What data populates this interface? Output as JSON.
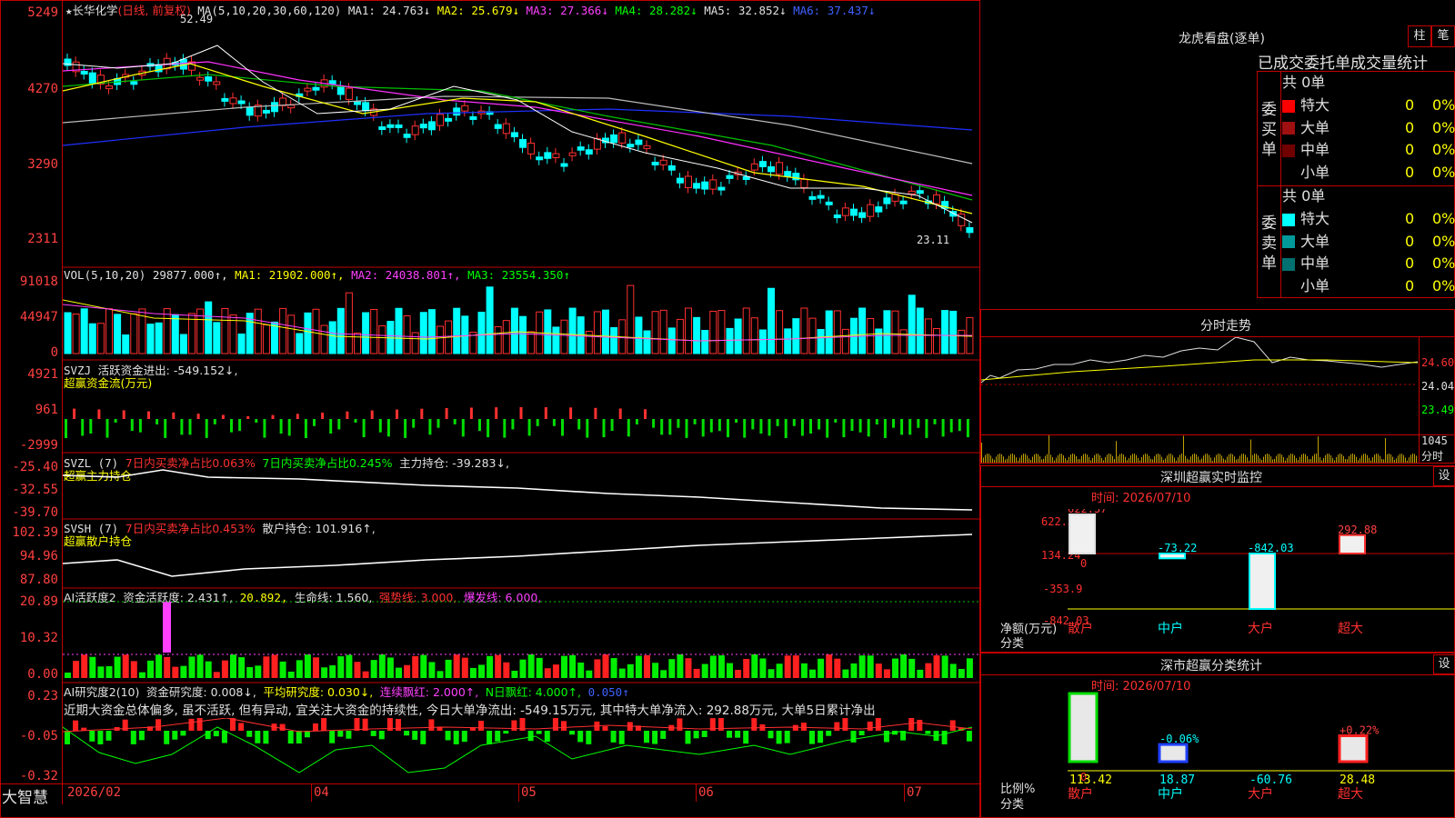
{
  "stock": {
    "star": "★",
    "name": "长华化学",
    "period": "(日线, 前复权)",
    "high_mark": "52.49",
    "low_mark": "23.11"
  },
  "ma_line": {
    "label": "MA(5,10,20,30,60,120)",
    "ma1": "MA1: 24.763↓",
    "ma2": "MA2: 25.679↓",
    "ma3": "MA3: 27.366↓",
    "ma4": "MA4: 28.282↓",
    "ma5": "MA5: 32.852↓",
    "ma6": "MA6: 37.437↓"
  },
  "price_axis": [
    "5249",
    "4270",
    "3290",
    "2311"
  ],
  "vol": {
    "label": "VOL(5,10,20)",
    "val": "29877.000↑,",
    "ma1": "MA1: 21902.000↑,",
    "ma2": "MA2: 24038.801↑,",
    "ma3": "MA3: 23554.350↑",
    "axis": [
      "91018",
      "44947",
      "0"
    ]
  },
  "svzj": {
    "label": "SVZJ",
    "line1": "活跃资金进出: -549.152↓,",
    "line2": "超赢资金流(万元)",
    "axis": [
      "4921",
      "961",
      "-2999"
    ]
  },
  "svzl": {
    "label": "SVZL (7)",
    "a": "7日内买卖净占比0.063%",
    "b": "7日内买卖净占比0.245%",
    "c": "主力持仓: -39.283↓,",
    "line2": "超赢主力持仓",
    "axis": [
      "-25.40",
      "-32.55",
      "-39.70"
    ]
  },
  "svsh": {
    "label": "SVSH (7)",
    "a": "7日内买卖净占比0.453%",
    "c": "散户持仓: 101.916↑,",
    "line2": "超赢散户持仓",
    "axis": [
      "102.39",
      "94.96",
      "87.80"
    ]
  },
  "ai1": {
    "label": "AI活跃度2",
    "a": "资金活跃度: 2.431↑,",
    "b": "20.892,",
    "c": "生命线: 1.560,",
    "d": "强势线: 3.000,",
    "e": "爆发线: 6.000,",
    "axis": [
      "20.89",
      "10.32",
      "0.00"
    ]
  },
  "ai2": {
    "label": "AI研究度2(10)",
    "a": "资金研究度: 0.008↓,",
    "b": "平均研究度: 0.030↓,",
    "c": "连续飘红: 2.000↑,",
    "d": "N日飘红: 4.000↑,",
    "e": "0.050↑",
    "comment": "近期大资金总体偏多, 虽不活跃, 但有异动, 宜关注大资金的持续性, 今日大单净流出: -549.15万元, 其中特大单净流入: 292.88万元, 大单5日累计净出",
    "axis": [
      "0.23",
      "-0.05",
      "-0.32"
    ]
  },
  "time_axis": {
    "brand": "大智慧",
    "labels": [
      "2026/02",
      "04",
      "05",
      "06",
      "07"
    ]
  },
  "longhu": {
    "title": "龙虎看盘(逐单)",
    "btn1": "柱",
    "btn2": "笔",
    "subtitle": "已成交委托单成交量统计",
    "buy": {
      "side": "委买单",
      "total": "共 0单",
      "rows": [
        {
          "name": "特大",
          "val": "0",
          "pct": "0%",
          "color": "#ff0000"
        },
        {
          "name": "大单",
          "val": "0",
          "pct": "0%",
          "color": "#a01010"
        },
        {
          "name": "中单",
          "val": "0",
          "pct": "0%",
          "color": "#700000"
        },
        {
          "name": "小单",
          "val": "0",
          "pct": "0%",
          "color": "#000000"
        }
      ]
    },
    "sell": {
      "side": "委卖单",
      "total": "共 0单",
      "rows": [
        {
          "name": "特大",
          "val": "0",
          "pct": "0%",
          "color": "#00ffff"
        },
        {
          "name": "大单",
          "val": "0",
          "pct": "0%",
          "color": "#009999"
        },
        {
          "name": "中单",
          "val": "0",
          "pct": "0%",
          "color": "#007070"
        },
        {
          "name": "小单",
          "val": "0",
          "pct": "0%",
          "color": "#000000"
        }
      ]
    }
  },
  "fenshi": {
    "title": "分时走势",
    "p1": "24.60",
    "p2": "24.04",
    "p3": "23.49",
    "vol": "1045",
    "vol_label": "分时"
  },
  "monitor": {
    "title": "深圳超赢实时监控",
    "btn": "设",
    "time": "时间: 2026/07/10",
    "axis": [
      "622.37",
      "134.24",
      "0",
      "-353.9",
      "-842.03"
    ],
    "ylabel": "净额(万元)",
    "xlabel": "分类",
    "cats": [
      "散户",
      "中户",
      "大户",
      "超大"
    ],
    "values": [
      622.37,
      -73.22,
      -842.03,
      292.88
    ],
    "value_labels": [
      "622.37",
      "-73.22",
      "-842.03",
      "292.88"
    ]
  },
  "classstat": {
    "title": "深市超赢分类统计",
    "btn": "设",
    "time": "时间: 2026/07/10",
    "axis": [
      "75",
      "50",
      "25",
      "0"
    ],
    "ylabel": "比例%",
    "xlabel": "分类",
    "cats": [
      "散户",
      "中户",
      "大户",
      "超大"
    ],
    "values": [
      113.42,
      18.87,
      -60.76,
      28.48
    ],
    "value_labels": [
      "113.42",
      "18.87",
      "-60.76",
      "28.48"
    ],
    "pct_labels": [
      "",
      "-0.06%",
      "",
      "+0.22%"
    ]
  },
  "chart_data": [
    {
      "type": "bar",
      "title": "深圳超赢实时监控",
      "ylabel": "净额(万元)",
      "xlabel": "分类",
      "categories": [
        "散户",
        "中户",
        "大户",
        "超大"
      ],
      "values": [
        622.37,
        -73.22,
        -842.03,
        292.88
      ],
      "ylim": [
        -842.03,
        622.37
      ]
    },
    {
      "type": "bar",
      "title": "深市超赢分类统计",
      "ylabel": "比例%",
      "xlabel": "分类",
      "categories": [
        "散户",
        "中户",
        "大户",
        "超大"
      ],
      "values": [
        113.42,
        18.87,
        -60.76,
        28.48
      ],
      "ylim": [
        0,
        75
      ]
    }
  ]
}
